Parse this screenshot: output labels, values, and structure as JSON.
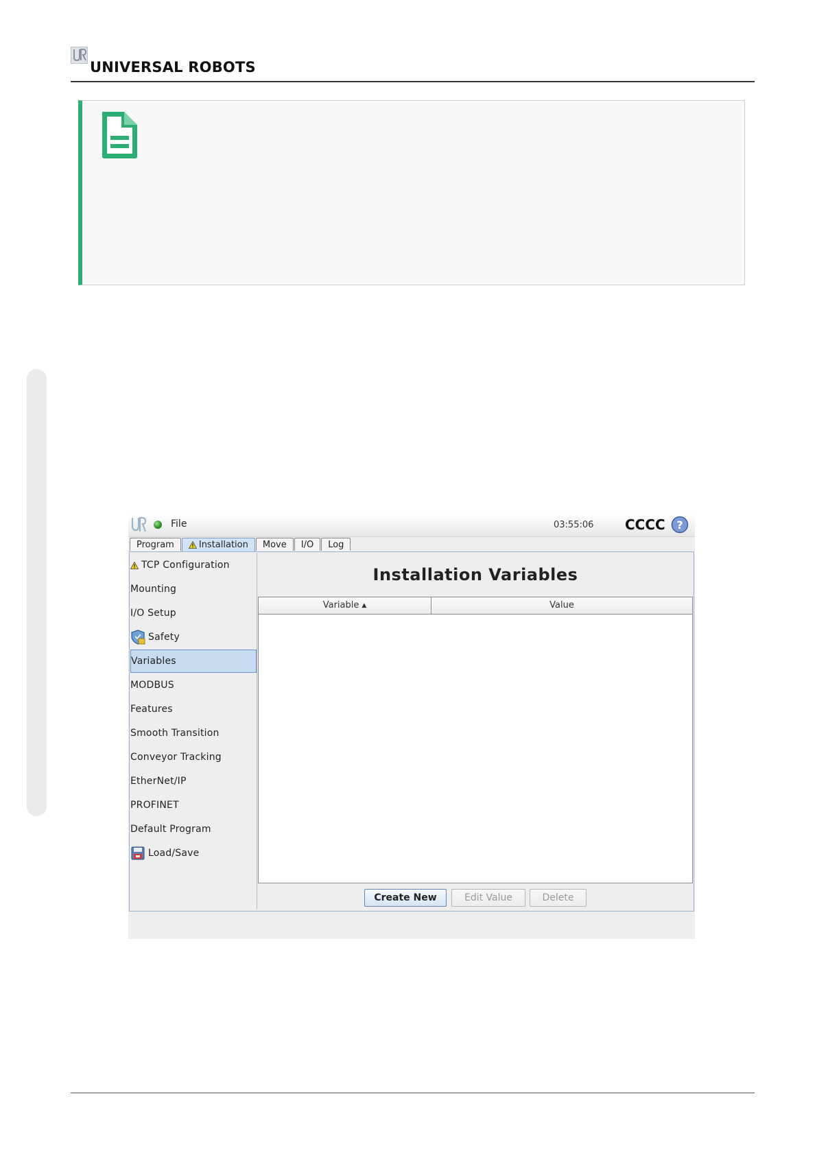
{
  "document": {
    "brand": "UNIVERSAL ROBOTS",
    "accent_color": "#2fae73",
    "note_icon": "document-icon"
  },
  "ui": {
    "topbar": {
      "file_menu": "File",
      "clock": "03:55:06",
      "robot_name": "CCCC",
      "help_icon": "help-icon",
      "status_color": "#2a8a25"
    },
    "tabs": [
      {
        "label": "Program",
        "active": false,
        "warning": false
      },
      {
        "label": "Installation",
        "active": true,
        "warning": true
      },
      {
        "label": "Move",
        "active": false,
        "warning": false
      },
      {
        "label": "I/O",
        "active": false,
        "warning": false
      },
      {
        "label": "Log",
        "active": false,
        "warning": false
      }
    ],
    "sidebar": {
      "items": [
        {
          "label": "TCP Configuration",
          "icon": "warning-icon"
        },
        {
          "label": "Mounting"
        },
        {
          "label": "I/O Setup"
        },
        {
          "label": "Safety",
          "icon": "safety-shield-icon"
        },
        {
          "label": "Variables",
          "selected": true
        },
        {
          "label": "MODBUS"
        },
        {
          "label": "Features"
        },
        {
          "label": "Smooth Transition"
        },
        {
          "label": "Conveyor Tracking"
        },
        {
          "label": "EtherNet/IP"
        },
        {
          "label": "PROFINET"
        },
        {
          "label": "Default Program"
        },
        {
          "label": "Load/Save",
          "icon": "floppy-disk-icon"
        }
      ]
    },
    "main": {
      "title": "Installation Variables",
      "table": {
        "columns": [
          "Variable",
          "Value"
        ],
        "sort_column": "Variable",
        "rows": []
      },
      "buttons": {
        "create_new": "Create New",
        "edit_value": "Edit Value",
        "delete": "Delete"
      }
    }
  }
}
